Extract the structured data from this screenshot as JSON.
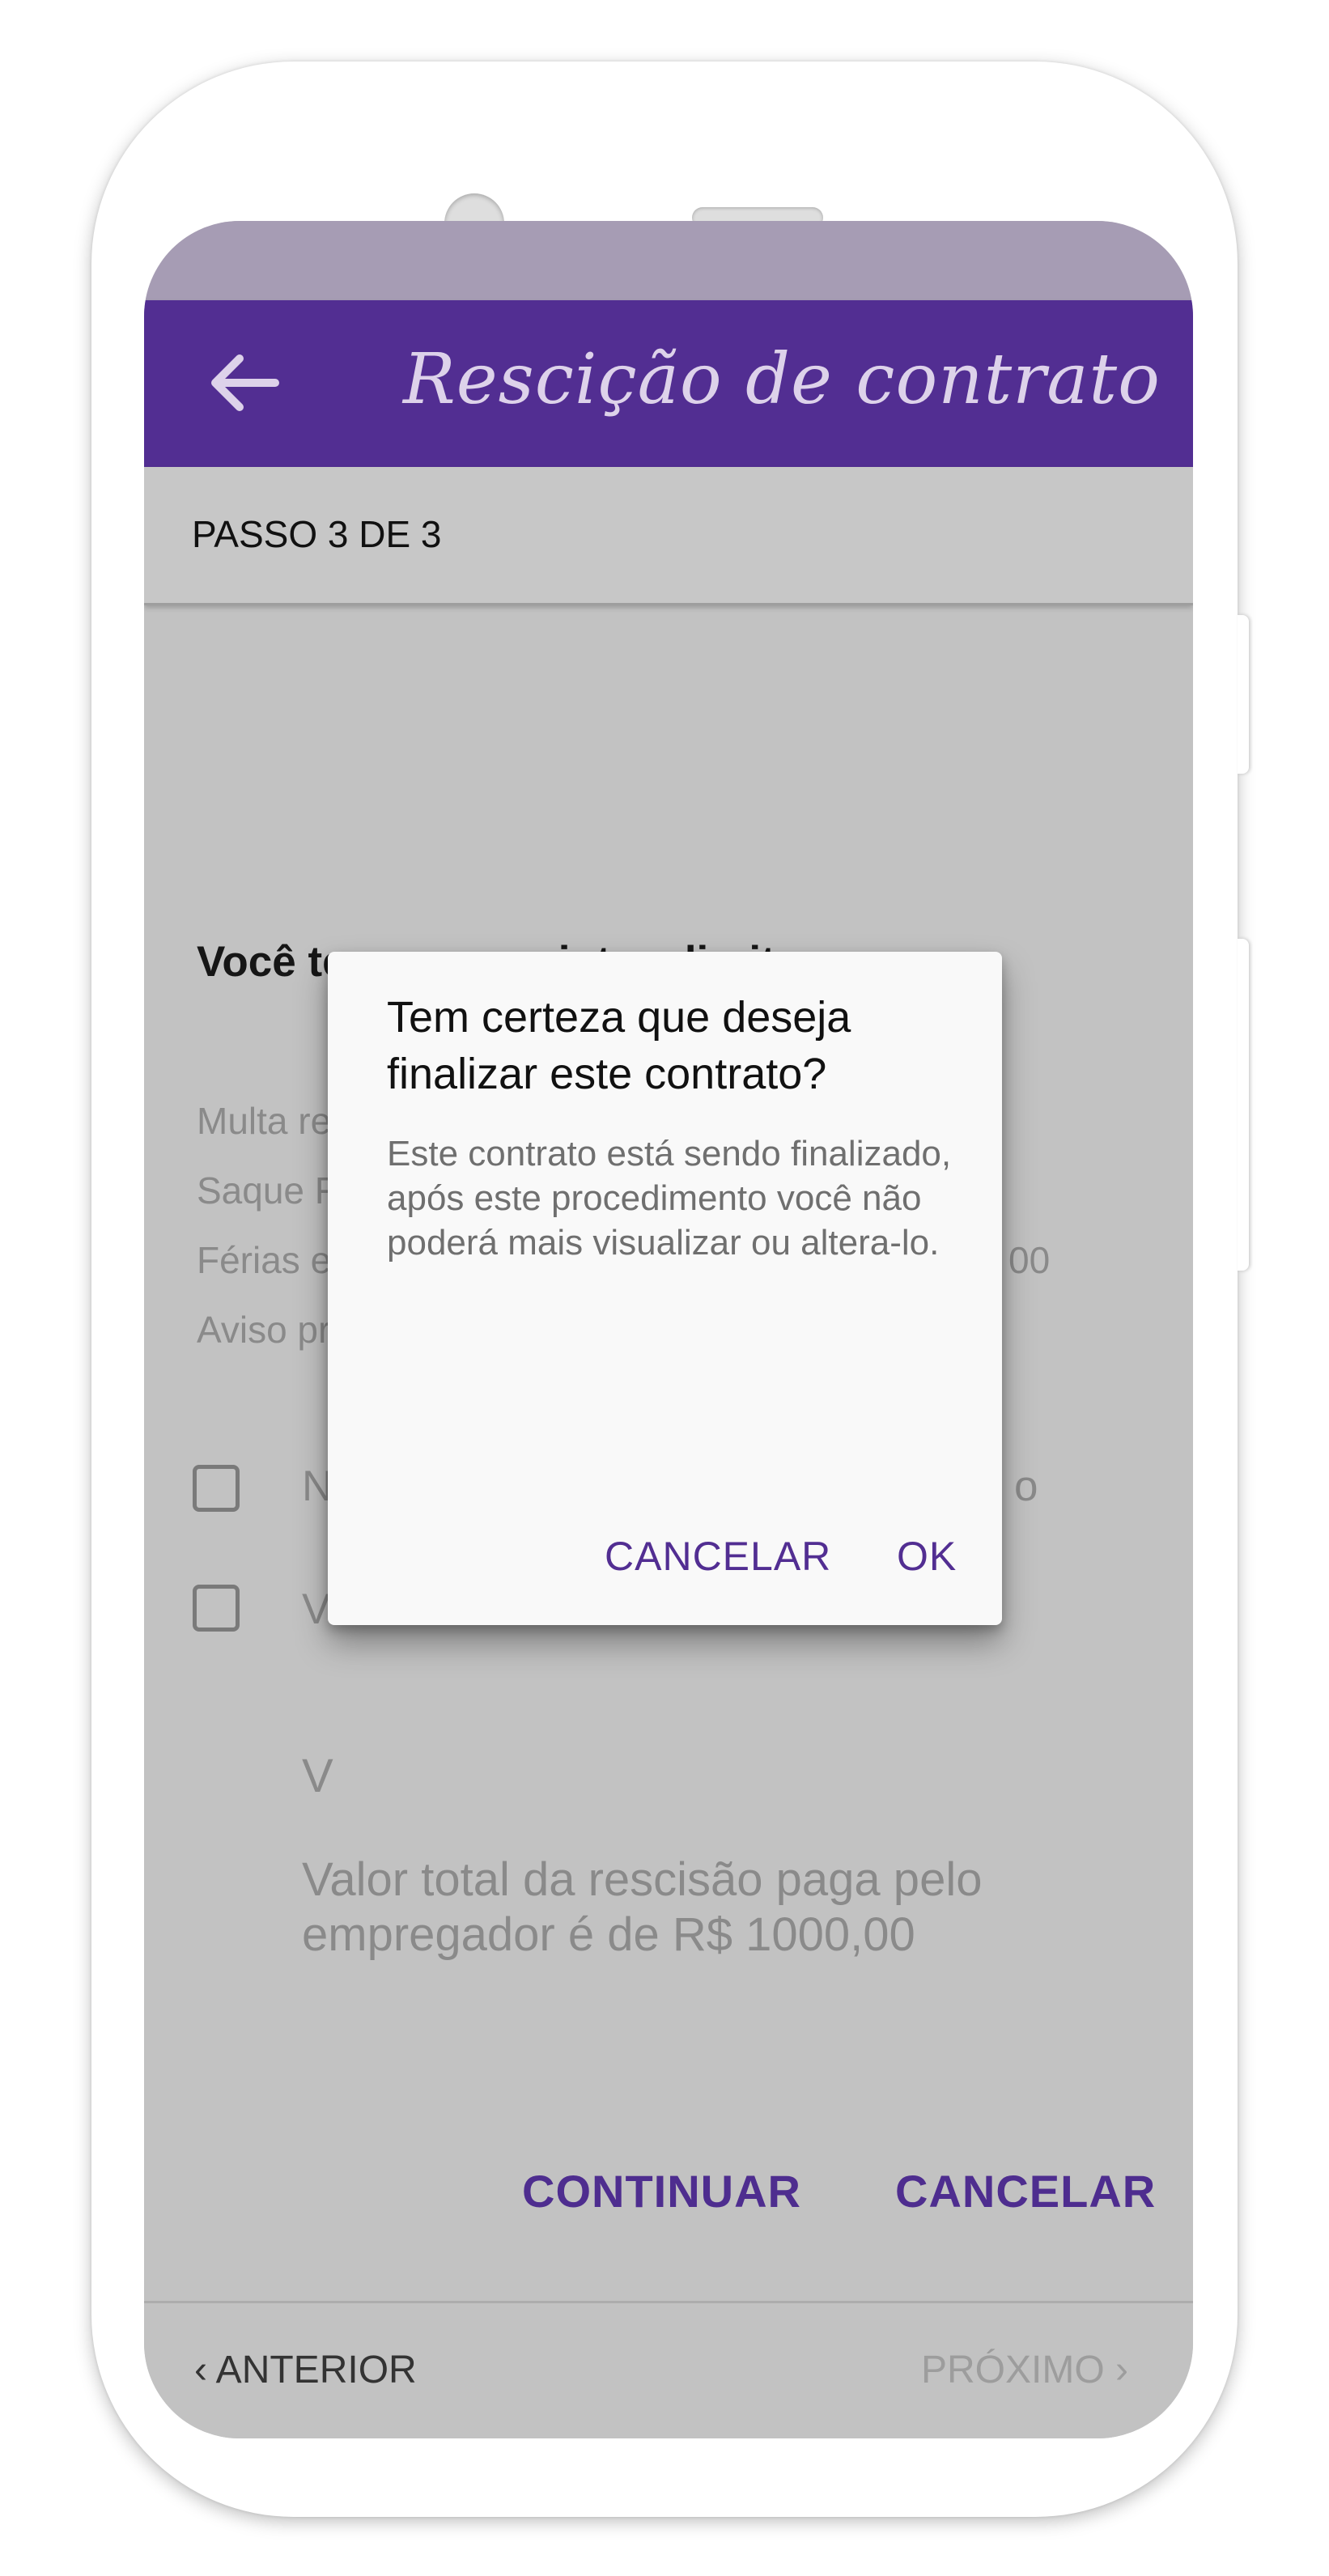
{
  "app": {
    "title": "Rescição de contrato",
    "step": "PASSO 3 DE 3"
  },
  "content": {
    "section_title": "Você tem os seguintes direitos",
    "rights": [
      "Multa rescisória FGTS de 40%",
      "Saque FGTS",
      "Férias e 1/3 de férias",
      "Aviso prévio"
    ],
    "rights_value_fragment": "00",
    "checkboxes": [
      {
        "label_start": "N",
        "label_end": "o",
        "checked": false
      },
      {
        "label_start": "V",
        "label_end": "",
        "checked": false
      }
    ],
    "value_fragment": "V",
    "total_line1": "Valor total da rescisão paga pelo",
    "total_line2": "empregador é de R$ 1000,00",
    "continue_label": "CONTINUAR",
    "cancel_label": "CANCELAR"
  },
  "footer": {
    "prev_label": "ANTERIOR",
    "next_label": "PRÓXIMO"
  },
  "dialog": {
    "title": "Tem certeza que deseja finalizar este contrato?",
    "message": "Este contrato está sendo finalizado, após este procedimento você não poderá mais visualizar ou altera-lo.",
    "cancel_label": "CANCELAR",
    "ok_label": "OK"
  },
  "colors": {
    "primary": "#522e92",
    "status_bar": "#a69cb4",
    "accent_text": "#4e2d8f",
    "scrim_background": "#c2c2c2"
  }
}
